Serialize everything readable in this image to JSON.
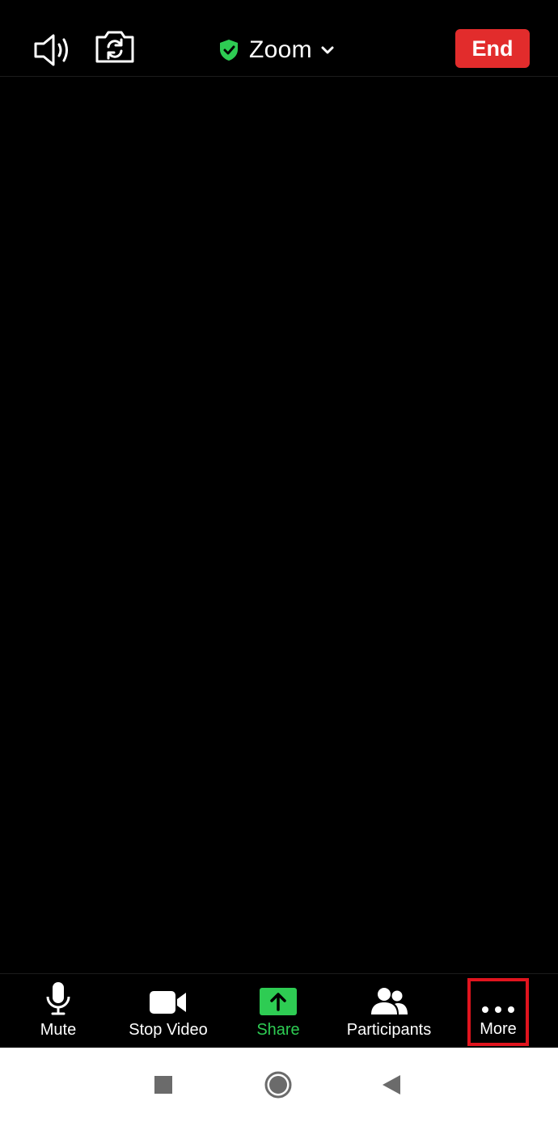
{
  "header": {
    "title": "Zoom",
    "end_label": "End",
    "icons": {
      "speaker": "speaker-icon",
      "switch_camera": "switch-camera-icon",
      "security": "shield-check-icon",
      "dropdown": "chevron-down-icon"
    }
  },
  "toolbar": {
    "mute_label": "Mute",
    "video_label": "Stop Video",
    "share_label": "Share",
    "participants_label": "Participants",
    "more_label": "More"
  },
  "colors": {
    "end": "#e22c2c",
    "share": "#2ecc53",
    "highlight": "#e0141e"
  },
  "navbar": {
    "icons": [
      "recents-icon",
      "home-icon",
      "back-icon"
    ]
  }
}
